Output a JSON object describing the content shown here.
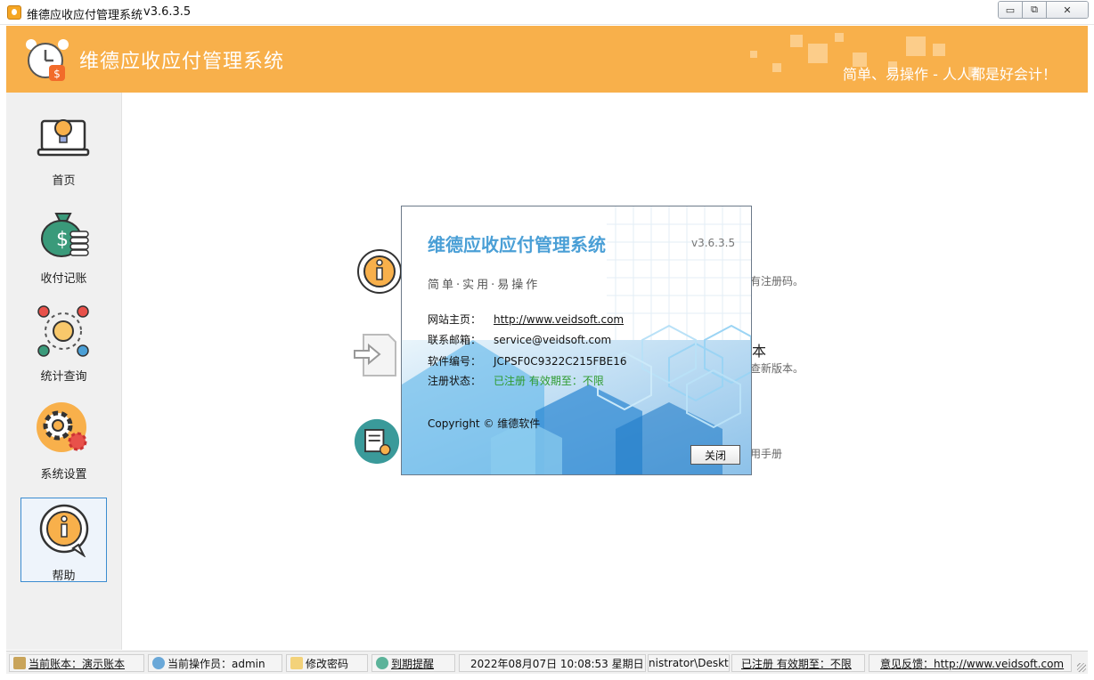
{
  "window": {
    "title": "维德应收应付管理系统",
    "version": "v3.6.3.5",
    "minimize_glyph": "▭",
    "restore_glyph": "⧉",
    "close_glyph": "✕"
  },
  "header": {
    "title": "维德应收应付管理系统",
    "slogan": "简单、易操作 - 人人都是好会计！"
  },
  "sidebar": {
    "items": [
      {
        "label": "首页",
        "icon": "laptop-lightbulb-icon",
        "active": false
      },
      {
        "label": "收付记账",
        "icon": "money-bag-icon",
        "active": false
      },
      {
        "label": "统计查询",
        "icon": "stats-cycle-icon",
        "active": false
      },
      {
        "label": "系统设置",
        "icon": "gear-icon",
        "active": false
      },
      {
        "label": "帮助",
        "icon": "info-bubble-icon",
        "active": true
      }
    ]
  },
  "main": {
    "partial_texts": {
      "register_hint": "有注册码。",
      "update_title": "本",
      "update_hint": "查新版本。",
      "manual_hint": "用手册"
    }
  },
  "dialog": {
    "title": "维德应收应付管理系统",
    "version": "v3.6.3.5",
    "slogan": "简单·实用·易操作",
    "website_label": "网站主页：",
    "website": "http://www.veidsoft.com",
    "email_label": "联系邮箱：",
    "email": "service@veidsoft.com",
    "serial_label": "软件编号：",
    "serial": "JCPSF0C9322C215FBE16",
    "status_label": "注册状态：",
    "status": "已注册 有效期至：不限",
    "copyright": "Copyright © 维德软件",
    "close_label": "关闭"
  },
  "statusbar": {
    "account": "当前账本：演示账本",
    "operator": "当前操作员：admin",
    "change_password": "修改密码",
    "expiry_reminder": "到期提醒",
    "datetime": "2022年08月07日 10:08:53 星期日",
    "path": "nistrator\\Deskto",
    "registration": "已注册 有效期至：不限",
    "feedback": "意见反馈：http://www.veidsoft.com"
  },
  "colors": {
    "header_orange": "#f8b04b",
    "accent_blue": "#4a9fd6",
    "green_status": "#2e9b2e"
  }
}
